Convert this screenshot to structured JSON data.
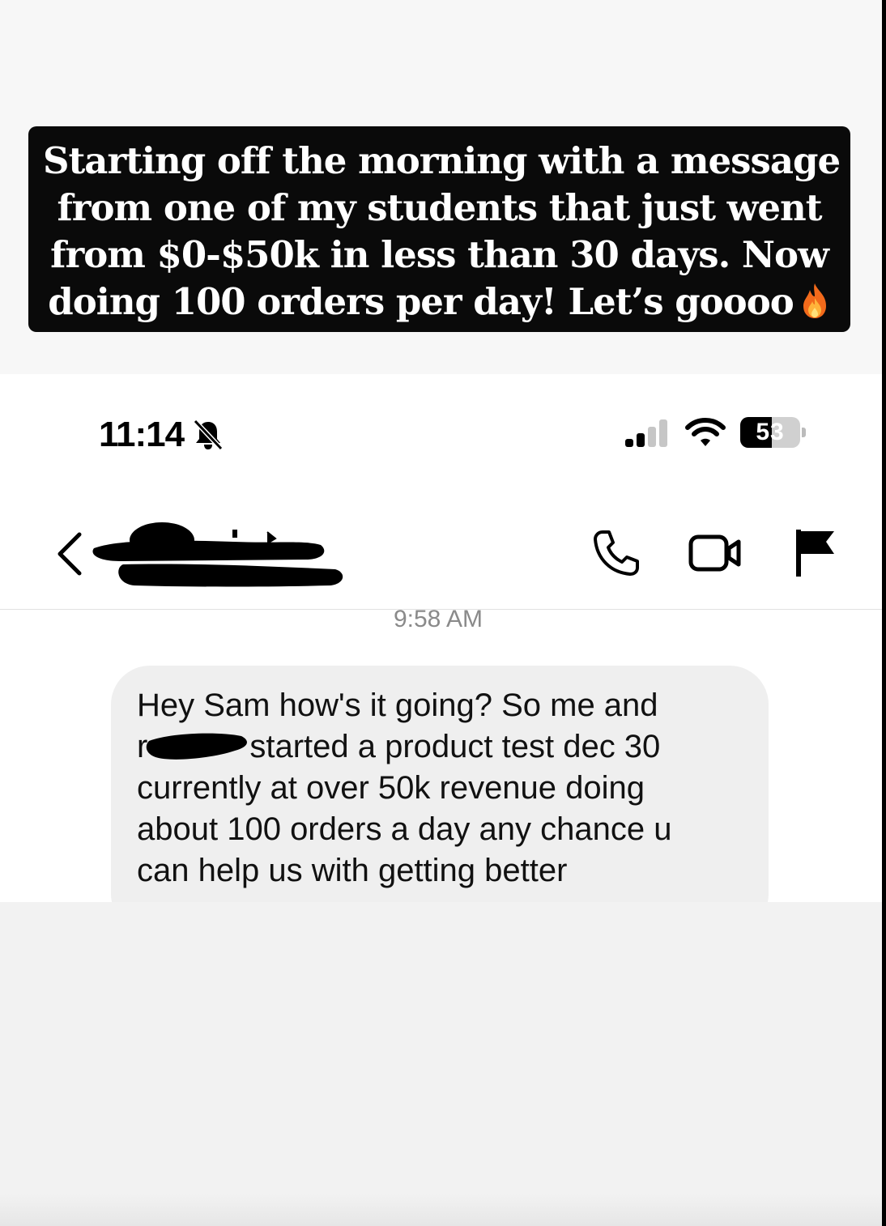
{
  "caption": {
    "lines": [
      "Starting off the morning with a message",
      "from one of my students that just went",
      "from $0-$50k in less than 30 days. Now",
      "doing 100 orders per day! Let’s goooo"
    ],
    "emoji_icon": "fire-icon"
  },
  "status_bar": {
    "time": "11:14",
    "silent_icon": "bell-slash-icon",
    "signal_bars": 2,
    "wifi_icon": "wifi-icon",
    "battery_level": "53"
  },
  "nav": {
    "back_icon": "chevron-left-icon",
    "contact_name_redacted": true,
    "actions": [
      "phone-icon",
      "video-icon",
      "flag-icon"
    ]
  },
  "thread": {
    "timestamp": "9:58 AM",
    "message": {
      "line1": "Hey Sam how's it going? So me and",
      "line2_prefix": "r",
      "line2": "started a product test dec 30",
      "line3": "currently at over 50k revenue doing",
      "line4": "about 100 orders a day any chance u",
      "line5": "can help us with getting better"
    }
  },
  "colors": {
    "caption_bg": "#0a0a0a",
    "bubble_bg": "#efefef",
    "timestamp": "#8a8a8a"
  }
}
